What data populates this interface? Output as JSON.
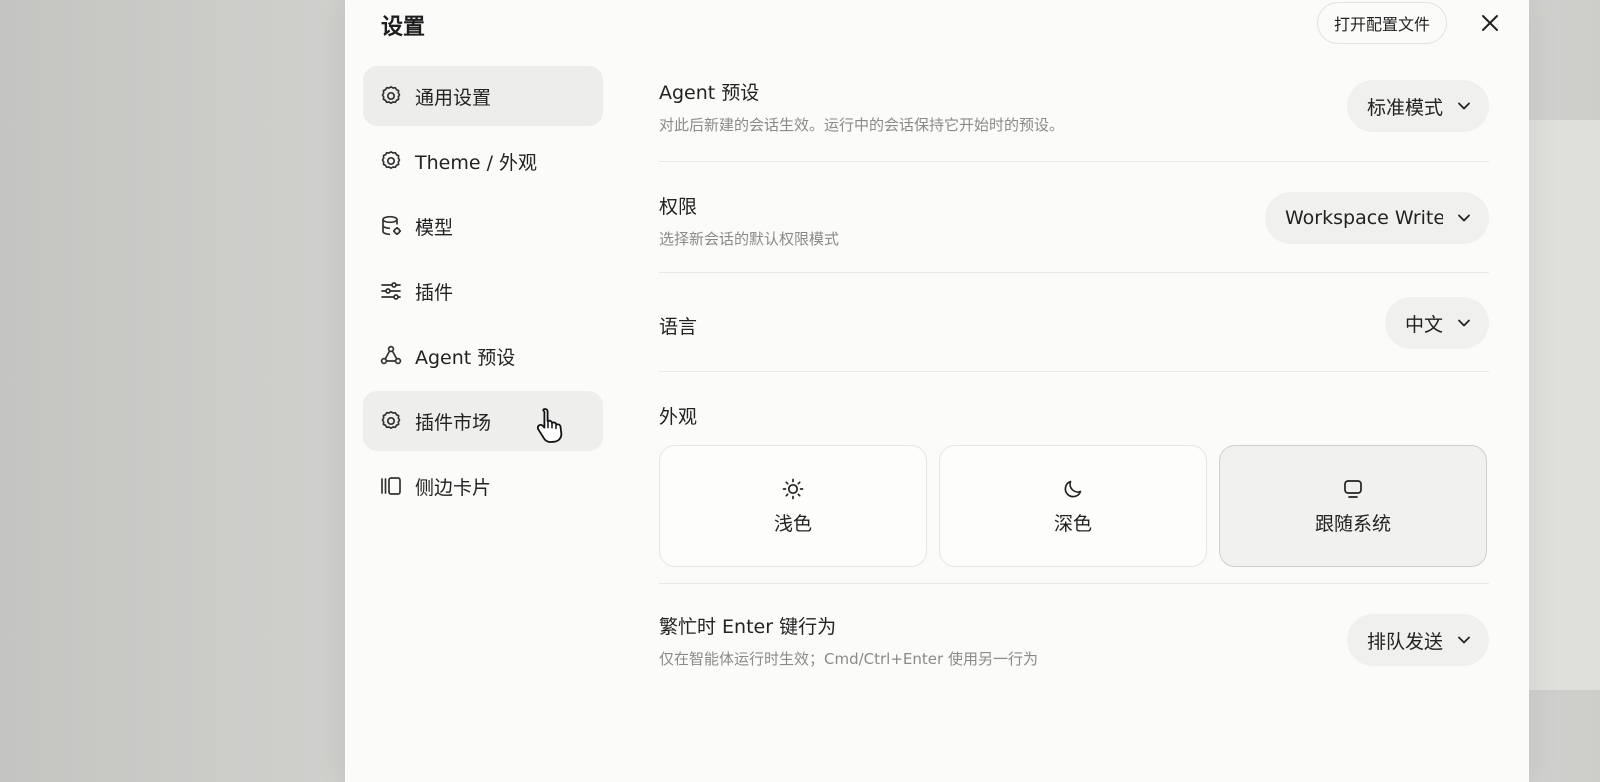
{
  "dialog": {
    "title": "设置",
    "open_config_label": "打开配置文件"
  },
  "sidebar": {
    "items": [
      {
        "label": "通用设置",
        "icon": "gear-icon",
        "state": "active"
      },
      {
        "label": "Theme / 外观",
        "icon": "gear-icon",
        "state": "normal"
      },
      {
        "label": "模型",
        "icon": "database-icon",
        "state": "normal"
      },
      {
        "label": "插件",
        "icon": "sliders-icon",
        "state": "normal"
      },
      {
        "label": "Agent 预设",
        "icon": "nodes-icon",
        "state": "normal"
      },
      {
        "label": "插件市场",
        "icon": "gear-icon",
        "state": "hover"
      },
      {
        "label": "侧边卡片",
        "icon": "cards-icon",
        "state": "normal"
      }
    ]
  },
  "settings": {
    "agent_preset": {
      "label": "Agent 预设",
      "description": "对此后新建的会话生效。运行中的会话保持它开始时的预设。",
      "value": "标准模式"
    },
    "permissions": {
      "label": "权限",
      "description": "选择新会话的默认权限模式",
      "value": "Workspace Write"
    },
    "language": {
      "label": "语言",
      "value": "中文"
    },
    "appearance": {
      "label": "外观",
      "options": [
        {
          "label": "浅色",
          "icon": "sun-icon",
          "selected": false
        },
        {
          "label": "深色",
          "icon": "moon-icon",
          "selected": false
        },
        {
          "label": "跟随系统",
          "icon": "monitor-icon",
          "selected": true
        }
      ]
    },
    "busy_enter": {
      "label": "繁忙时 Enter 键行为",
      "description": "仅在智能体运行时生效；Cmd/Ctrl+Enter 使用另一行为",
      "value": "排队发送"
    }
  }
}
